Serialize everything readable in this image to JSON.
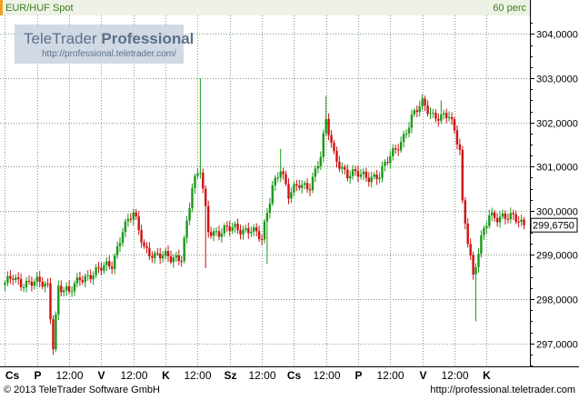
{
  "header": {
    "instrument": "EUR/HUF Spot",
    "interval": "60 perc"
  },
  "watermark": {
    "title_regular": "TeleTrader ",
    "title_bold": "Professional",
    "url": "http://professional.teletrader.com/"
  },
  "price_label": "299,6750",
  "footer": {
    "copyright": "© 2013 TeleTrader Software GmbH",
    "url": "http://professional.teletrader.com"
  },
  "colors": {
    "up": "#1a9a1a",
    "down": "#d01010",
    "grid": "#7f9f7f",
    "header_bg": "#eef2e6",
    "header_text": "#3c7f1e",
    "axis_bg": "#ffffff",
    "watermark_bg": "#c9d2e0"
  },
  "chart_data": {
    "type": "candlestick",
    "title": "EUR/HUF Spot",
    "interval": "60 perc",
    "y_ticks": [
      "304,0000",
      "303,0000",
      "302,0000",
      "301,0000",
      "300,0000",
      "299,0000",
      "298,0000",
      "297,0000"
    ],
    "y_tick_values": [
      304,
      303,
      302,
      301,
      300,
      299,
      298,
      297
    ],
    "ylim": [
      296.5,
      304.4
    ],
    "last_price": 299.675,
    "x_labels": [
      "Cs",
      "P",
      "12:00",
      "V",
      "12:00",
      "K",
      "12:00",
      "Sz",
      "12:00",
      "Cs",
      "12:00",
      "P",
      "12:00",
      "V",
      "12:00",
      "K"
    ],
    "x_label_bold": [
      true,
      true,
      false,
      true,
      false,
      true,
      false,
      true,
      false,
      true,
      false,
      true,
      false,
      true,
      false,
      true
    ],
    "n_candles": 195,
    "x_label_candle_index": [
      0,
      12,
      24,
      36,
      48,
      60,
      72,
      84,
      96,
      108,
      120,
      132,
      144,
      156,
      168,
      180
    ],
    "anchors": [
      {
        "i": 0,
        "p": 298.3
      },
      {
        "i": 3,
        "p": 298.5
      },
      {
        "i": 6,
        "p": 298.4
      },
      {
        "i": 12,
        "p": 298.35
      },
      {
        "i": 16,
        "p": 298.3
      },
      {
        "i": 18,
        "p": 297.0
      },
      {
        "i": 20,
        "p": 298.3
      },
      {
        "i": 24,
        "p": 298.1
      },
      {
        "i": 28,
        "p": 298.5
      },
      {
        "i": 34,
        "p": 298.6
      },
      {
        "i": 40,
        "p": 298.8
      },
      {
        "i": 44,
        "p": 299.6
      },
      {
        "i": 48,
        "p": 299.9
      },
      {
        "i": 52,
        "p": 299.2
      },
      {
        "i": 56,
        "p": 299.0
      },
      {
        "i": 62,
        "p": 298.9
      },
      {
        "i": 66,
        "p": 299.0
      },
      {
        "i": 70,
        "p": 300.5
      },
      {
        "i": 73,
        "p": 300.9
      },
      {
        "i": 76,
        "p": 299.6
      },
      {
        "i": 80,
        "p": 299.5
      },
      {
        "i": 86,
        "p": 299.6
      },
      {
        "i": 92,
        "p": 299.6
      },
      {
        "i": 96,
        "p": 299.3
      },
      {
        "i": 100,
        "p": 300.6
      },
      {
        "i": 103,
        "p": 301.0
      },
      {
        "i": 106,
        "p": 300.3
      },
      {
        "i": 110,
        "p": 300.6
      },
      {
        "i": 114,
        "p": 300.6
      },
      {
        "i": 118,
        "p": 301.2
      },
      {
        "i": 120,
        "p": 302.0
      },
      {
        "i": 123,
        "p": 301.3
      },
      {
        "i": 128,
        "p": 300.8
      },
      {
        "i": 134,
        "p": 300.8
      },
      {
        "i": 140,
        "p": 300.8
      },
      {
        "i": 144,
        "p": 301.2
      },
      {
        "i": 148,
        "p": 301.6
      },
      {
        "i": 152,
        "p": 302.1
      },
      {
        "i": 156,
        "p": 302.4
      },
      {
        "i": 160,
        "p": 302.2
      },
      {
        "i": 166,
        "p": 302.1
      },
      {
        "i": 170,
        "p": 301.4
      },
      {
        "i": 171,
        "p": 300.2
      },
      {
        "i": 174,
        "p": 299.0
      },
      {
        "i": 175,
        "p": 298.5
      },
      {
        "i": 178,
        "p": 299.3
      },
      {
        "i": 181,
        "p": 299.9
      },
      {
        "i": 186,
        "p": 299.9
      },
      {
        "i": 190,
        "p": 299.8
      },
      {
        "i": 194,
        "p": 299.675
      }
    ],
    "spikes": [
      {
        "i": 19,
        "low": 296.8
      },
      {
        "i": 73,
        "high": 303.0
      },
      {
        "i": 75,
        "low": 298.7
      },
      {
        "i": 120,
        "high": 302.6
      },
      {
        "i": 163,
        "high": 302.5
      },
      {
        "i": 176,
        "low": 297.5
      },
      {
        "i": 98,
        "low": 298.8
      },
      {
        "i": 103,
        "high": 301.4
      }
    ]
  }
}
